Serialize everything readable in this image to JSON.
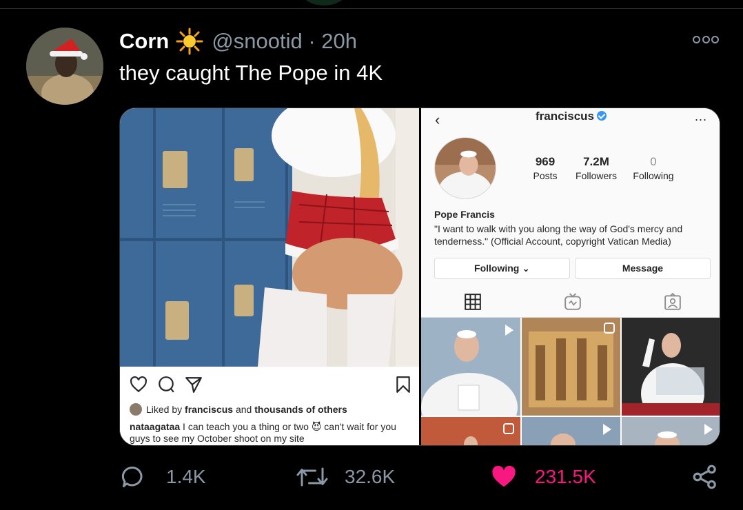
{
  "tweet": {
    "author_name": "Corn",
    "author_emoji": "sun-emoji",
    "handle_time": "@snootid · 20h",
    "text": "they caught The Pope in 4K",
    "more_icon": "more-options-icon"
  },
  "left_post": {
    "liked_by_prefix": "Liked by",
    "liked_by_user": "franciscus",
    "liked_by_middle": "and",
    "liked_by_rest": "thousands of others",
    "caption_user": "nataagataa",
    "caption_text": "I can teach you a thing or two 😈 can't wait for you guys to see my October shoot on my site"
  },
  "right_profile": {
    "username": "franciscus",
    "more": "...",
    "posts_count": "969",
    "posts_label": "Posts",
    "followers_count": "7.2M",
    "followers_label": "Followers",
    "following_count": "0",
    "following_label": "Following",
    "display_name": "Pope Francis",
    "bio": "\"I want to walk with you along the way of God's mercy and tenderness.\" (Official Account, copyright Vatican Media)",
    "following_button": "Following ⌄",
    "message_button": "Message"
  },
  "stats": {
    "replies": "1.4K",
    "retweets": "32.6K",
    "likes": "231.5K"
  },
  "colors": {
    "background": "#000000",
    "muted": "#8b98a5",
    "like": "#f91880",
    "verified": "#3897f0"
  }
}
